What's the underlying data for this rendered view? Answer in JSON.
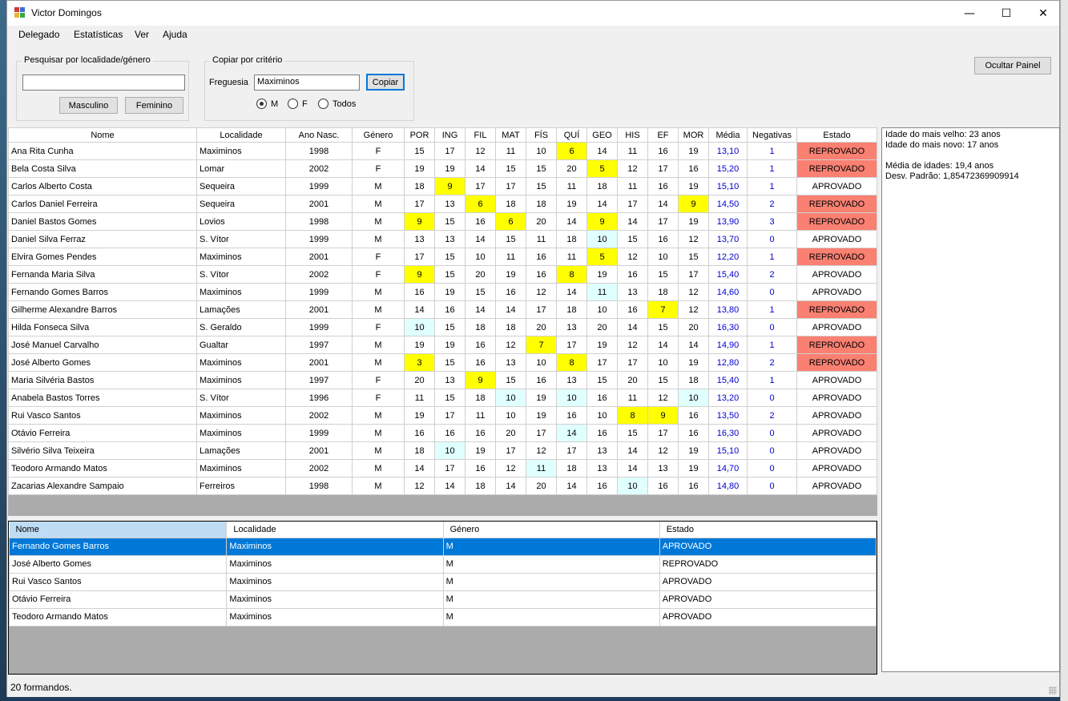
{
  "window": {
    "title": "Victor Domingos",
    "min_glyph": "—",
    "max_glyph": "☐",
    "close_glyph": "✕"
  },
  "menu": [
    "Delegado",
    "Estatísticas",
    "Ver",
    "Ajuda"
  ],
  "search_group": {
    "legend": "Pesquisar por localidade/género",
    "input_value": "",
    "btn_male": "Masculino",
    "btn_female": "Feminino"
  },
  "copy_group": {
    "legend": "Copiar por critério",
    "freguesia_label": "Freguesia",
    "freguesia_value": "Maximinos",
    "copy_button": "Copiar",
    "radios": [
      {
        "label": "M",
        "checked": true
      },
      {
        "label": "F",
        "checked": false
      },
      {
        "label": "Todos",
        "checked": false
      }
    ]
  },
  "hide_panel_button": "Ocultar Painel",
  "colors": {
    "highlight_low": "#ffff00",
    "highlight_high": "#e0ffff",
    "reprovado": "#fa8072",
    "average": "#0000cd",
    "selection": "#0078d7"
  },
  "grid": {
    "columns": [
      "Nome",
      "Localidade",
      "Ano Nasc.",
      "Género",
      "POR",
      "ING",
      "FIL",
      "MAT",
      "FÍS",
      "QUÍ",
      "GEO",
      "HIS",
      "EF",
      "MOR",
      "Média",
      "Negativas",
      "Estado"
    ],
    "rows": [
      {
        "nome": "Ana Rita Cunha",
        "localidade": "Maximinos",
        "ano": "1998",
        "genero": "F",
        "notas": [
          15,
          17,
          12,
          11,
          10,
          6,
          14,
          11,
          16,
          19
        ],
        "media": "13,10",
        "negativas": "1",
        "estado": "REPROVADO"
      },
      {
        "nome": "Bela Costa Silva",
        "localidade": "Lomar",
        "ano": "2002",
        "genero": "F",
        "notas": [
          19,
          19,
          14,
          15,
          15,
          20,
          5,
          12,
          17,
          16
        ],
        "media": "15,20",
        "negativas": "1",
        "estado": "REPROVADO"
      },
      {
        "nome": "Carlos Alberto Costa",
        "localidade": "Sequeira",
        "ano": "1999",
        "genero": "M",
        "notas": [
          18,
          9,
          17,
          17,
          15,
          11,
          18,
          11,
          16,
          19
        ],
        "media": "15,10",
        "negativas": "1",
        "estado": "APROVADO"
      },
      {
        "nome": "Carlos Daniel Ferreira",
        "localidade": "Sequeira",
        "ano": "2001",
        "genero": "M",
        "notas": [
          17,
          13,
          6,
          18,
          18,
          19,
          14,
          17,
          14,
          9
        ],
        "media": "14,50",
        "negativas": "2",
        "estado": "REPROVADO"
      },
      {
        "nome": "Daniel Bastos Gomes",
        "localidade": "Lovios",
        "ano": "1998",
        "genero": "M",
        "notas": [
          9,
          15,
          16,
          6,
          20,
          14,
          9,
          14,
          17,
          19
        ],
        "media": "13,90",
        "negativas": "3",
        "estado": "REPROVADO"
      },
      {
        "nome": "Daniel Silva Ferraz",
        "localidade": "S. Vítor",
        "ano": "1999",
        "genero": "M",
        "notas": [
          13,
          13,
          14,
          15,
          11,
          18,
          10,
          15,
          16,
          12
        ],
        "media": "13,70",
        "negativas": "0",
        "estado": "APROVADO"
      },
      {
        "nome": "Elvira Gomes Pendes",
        "localidade": "Maximinos",
        "ano": "2001",
        "genero": "F",
        "notas": [
          17,
          15,
          10,
          11,
          16,
          11,
          5,
          12,
          10,
          15
        ],
        "media": "12,20",
        "negativas": "1",
        "estado": "REPROVADO"
      },
      {
        "nome": "Fernanda Maria Silva",
        "localidade": "S. Vítor",
        "ano": "2002",
        "genero": "F",
        "notas": [
          9,
          15,
          20,
          19,
          16,
          8,
          19,
          16,
          15,
          17
        ],
        "media": "15,40",
        "negativas": "2",
        "estado": "APROVADO"
      },
      {
        "nome": "Fernando Gomes Barros",
        "localidade": "Maximinos",
        "ano": "1999",
        "genero": "M",
        "notas": [
          16,
          19,
          15,
          16,
          12,
          14,
          11,
          13,
          18,
          12
        ],
        "media": "14,60",
        "negativas": "0",
        "estado": "APROVADO"
      },
      {
        "nome": "Gilherme Alexandre Barros",
        "localidade": "Lamações",
        "ano": "2001",
        "genero": "M",
        "notas": [
          14,
          16,
          14,
          14,
          17,
          18,
          10,
          16,
          7,
          12
        ],
        "media": "13,80",
        "negativas": "1",
        "estado": "REPROVADO"
      },
      {
        "nome": "Hilda Fonseca Silva",
        "localidade": "S. Geraldo",
        "ano": "1999",
        "genero": "F",
        "notas": [
          10,
          15,
          18,
          18,
          20,
          13,
          20,
          14,
          15,
          20
        ],
        "media": "16,30",
        "negativas": "0",
        "estado": "APROVADO"
      },
      {
        "nome": "José Manuel Carvalho",
        "localidade": "Gualtar",
        "ano": "1997",
        "genero": "M",
        "notas": [
          19,
          19,
          16,
          12,
          7,
          17,
          19,
          12,
          14,
          14
        ],
        "media": "14,90",
        "negativas": "1",
        "estado": "REPROVADO"
      },
      {
        "nome": "José Alberto Gomes",
        "localidade": "Maximinos",
        "ano": "2001",
        "genero": "M",
        "notas": [
          3,
          15,
          16,
          13,
          10,
          8,
          17,
          17,
          10,
          19
        ],
        "media": "12,80",
        "negativas": "2",
        "estado": "REPROVADO"
      },
      {
        "nome": "Maria Silvéria Bastos",
        "localidade": "Maximinos",
        "ano": "1997",
        "genero": "F",
        "notas": [
          20,
          13,
          9,
          15,
          16,
          13,
          15,
          20,
          15,
          18
        ],
        "media": "15,40",
        "negativas": "1",
        "estado": "APROVADO"
      },
      {
        "nome": "Anabela Bastos Torres",
        "localidade": "S. Vítor",
        "ano": "1996",
        "genero": "F",
        "notas": [
          11,
          15,
          18,
          10,
          19,
          10,
          16,
          11,
          12,
          10
        ],
        "media": "13,20",
        "negativas": "0",
        "estado": "APROVADO"
      },
      {
        "nome": "Rui Vasco Santos",
        "localidade": "Maximinos",
        "ano": "2002",
        "genero": "M",
        "notas": [
          19,
          17,
          11,
          10,
          19,
          16,
          10,
          8,
          9,
          16
        ],
        "media": "13,50",
        "negativas": "2",
        "estado": "APROVADO"
      },
      {
        "nome": "Otávio Ferreira",
        "localidade": "Maximinos",
        "ano": "1999",
        "genero": "M",
        "notas": [
          16,
          16,
          16,
          20,
          17,
          14,
          16,
          15,
          17,
          16
        ],
        "media": "16,30",
        "negativas": "0",
        "estado": "APROVADO"
      },
      {
        "nome": "Silvério Silva Teixeira",
        "localidade": "Lamações",
        "ano": "2001",
        "genero": "M",
        "notas": [
          18,
          10,
          19,
          17,
          12,
          17,
          13,
          14,
          12,
          19
        ],
        "media": "15,10",
        "negativas": "0",
        "estado": "APROVADO"
      },
      {
        "nome": "Teodoro Armando Matos",
        "localidade": "Maximinos",
        "ano": "2002",
        "genero": "M",
        "notas": [
          14,
          17,
          16,
          12,
          11,
          18,
          13,
          14,
          13,
          19
        ],
        "media": "14,70",
        "negativas": "0",
        "estado": "APROVADO"
      },
      {
        "nome": "Zacarias Alexandre Sampaio",
        "localidade": "Ferreiros",
        "ano": "1998",
        "genero": "M",
        "notas": [
          12,
          14,
          18,
          14,
          20,
          14,
          16,
          10,
          16,
          16
        ],
        "media": "14,80",
        "negativas": "0",
        "estado": "APROVADO"
      }
    ]
  },
  "side_panel": {
    "lines": [
      "Idade do mais velho: 23 anos",
      "Idade do mais novo: 17 anos",
      "",
      "Média de idades: 19,4 anos",
      "Desv. Padrão: 1,85472369909914"
    ]
  },
  "grid2": {
    "columns": [
      "Nome",
      "Localidade",
      "Género",
      "Estado"
    ],
    "rows": [
      {
        "cells": [
          "Fernando Gomes Barros",
          "Maximinos",
          "M",
          "APROVADO"
        ],
        "selected": true
      },
      {
        "cells": [
          "José Alberto Gomes",
          "Maximinos",
          "M",
          "REPROVADO"
        ],
        "selected": false
      },
      {
        "cells": [
          "Rui Vasco Santos",
          "Maximinos",
          "M",
          "APROVADO"
        ],
        "selected": false
      },
      {
        "cells": [
          "Otávio Ferreira",
          "Maximinos",
          "M",
          "APROVADO"
        ],
        "selected": false
      },
      {
        "cells": [
          "Teodoro Armando Matos",
          "Maximinos",
          "M",
          "APROVADO"
        ],
        "selected": false
      }
    ]
  },
  "status": "20 formandos."
}
